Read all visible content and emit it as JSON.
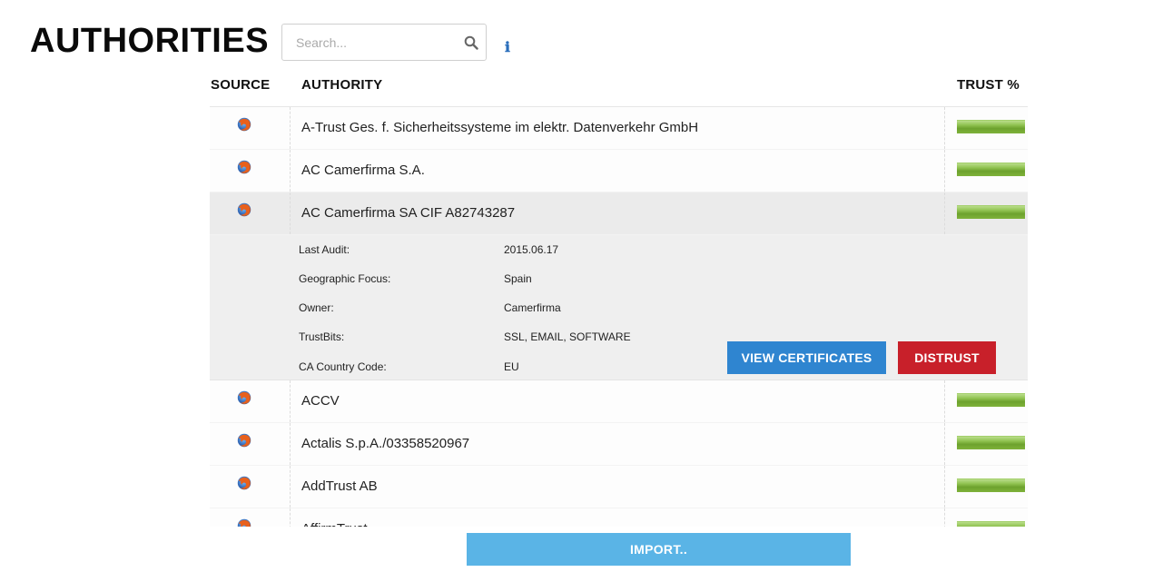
{
  "page": {
    "title": "AUTHORITIES"
  },
  "search": {
    "placeholder": "Search...",
    "value": "",
    "icon": "search-icon"
  },
  "info_icon": "info-icon",
  "table": {
    "headers": {
      "source": "SOURCE",
      "authority": "AUTHORITY",
      "trust": "TRUST %"
    },
    "rows": [
      {
        "source_icon": "firefox-icon",
        "authority": "A-Trust Ges. f. Sicherheitssysteme im elektr. Datenverkehr GmbH",
        "trust": 1.0
      },
      {
        "source_icon": "firefox-icon",
        "authority": "AC Camerfirma S.A.",
        "trust": 1.0
      },
      {
        "source_icon": "firefox-icon",
        "authority": "AC Camerfirma SA CIF A82743287",
        "trust": 1.0,
        "selected": true
      },
      {
        "source_icon": "firefox-icon",
        "authority": "ACCV",
        "trust": 1.0
      },
      {
        "source_icon": "firefox-icon",
        "authority": "Actalis S.p.A./03358520967",
        "trust": 1.0
      },
      {
        "source_icon": "firefox-icon",
        "authority": "AddTrust AB",
        "trust": 1.0
      },
      {
        "source_icon": "firefox-icon",
        "authority": "AffirmTrust",
        "trust": 1.0
      }
    ],
    "details": {
      "fields": [
        {
          "label": "Last Audit:",
          "value": "2015.06.17"
        },
        {
          "label": "Geographic Focus:",
          "value": "Spain"
        },
        {
          "label": "Owner:",
          "value": "Camerfirma"
        },
        {
          "label": "TrustBits:",
          "value": "SSL, EMAIL, SOFTWARE"
        },
        {
          "label": "CA Country Code:",
          "value": "EU"
        }
      ],
      "view_certificates_label": "VIEW CERTIFICATES",
      "distrust_label": "DISTRUST"
    }
  },
  "import_label": "IMPORT..",
  "colors": {
    "trust_bar": "#7fb23a",
    "view_button": "#2f85d0",
    "distrust_button": "#c8202a",
    "import_button": "#5ab4e6",
    "selected_row": "#ebebeb"
  }
}
